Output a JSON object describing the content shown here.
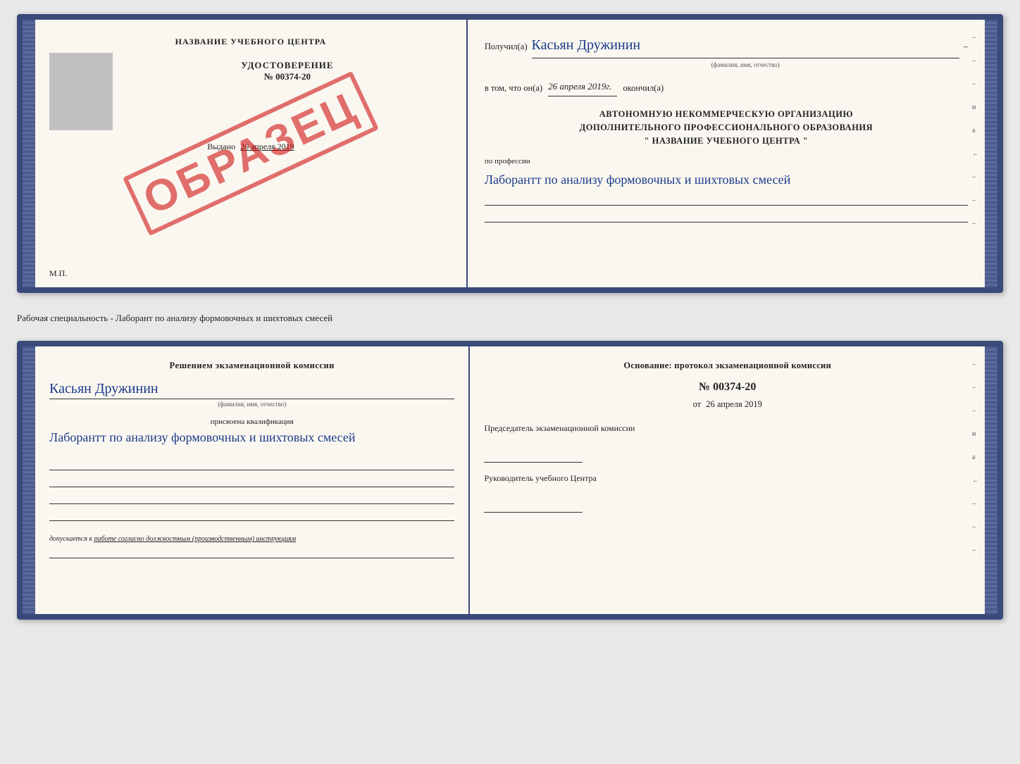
{
  "top_document": {
    "left_page": {
      "header": "НАЗВАНИЕ УЧЕБНОГО ЦЕНТРА",
      "gray_box_label": "фото",
      "udostoverenie_label": "УДОСТОВЕРЕНИЕ",
      "number": "№ 00374-20",
      "vydano": "Выдано",
      "vydano_date": "26 апреля 2019",
      "mp": "М.П.",
      "stamp": "ОБРАЗЕЦ"
    },
    "right_page": {
      "poluchil": "Получил(а)",
      "name_handwritten": "Касьян Дружинин",
      "fio_hint": "(фамилия, имя, отчество)",
      "dash": "–",
      "vtom_prefix": "в том, что он(а)",
      "date_handwritten": "26 апреля 2019г.",
      "okonchil": "окончил(а)",
      "org_line1": "АВТОНОМНУЮ НЕКОММЕРЧЕСКУЮ ОРГАНИЗАЦИЮ",
      "org_line2": "ДОПОЛНИТЕЛЬНОГО ПРОФЕССИОНАЛЬНОГО ОБРАЗОВАНИЯ",
      "org_line3": "\"  НАЗВАНИЕ УЧЕБНОГО ЦЕНТРА  \"",
      "po_professii": "по профессии",
      "professiya_handwritten": "Лаборантт по анализу формовочных и шихтовых смесей",
      "dashes_right": [
        "–",
        "–",
        "–",
        "и",
        "а",
        "←",
        "–",
        "–",
        "–"
      ]
    }
  },
  "middle_text": "Рабочая специальность - Лаборант по анализу формовочных и шихтовых смесей",
  "bottom_document": {
    "left_page": {
      "header": "Решением экзаменационной комиссии",
      "name_handwritten": "Касьян Дружинин",
      "fio_hint": "(фамилия, имя, отчество)",
      "prisvoena_label": "присвоена квалификация",
      "kvali_handwritten": "Лаборантт по анализу формовочных и шихтовых смесей",
      "lines": [
        "",
        "",
        "",
        ""
      ],
      "dopuskaetsya": "допускается к",
      "dopusk_text": "работе согласно должностным (производственным) инструкциям"
    },
    "right_page": {
      "osnovaniye": "Основание: протокол экзаменационной комиссии",
      "number": "№ 00374-20",
      "ot_prefix": "от",
      "date": "26 апреля 2019",
      "predsedatel_label": "Председатель экзаменационной комиссии",
      "rukovoditel_label": "Руководитель учебного Центра",
      "dashes_right": [
        "–",
        "–",
        "–",
        "и",
        "а",
        "←",
        "–",
        "–",
        "–"
      ]
    }
  }
}
